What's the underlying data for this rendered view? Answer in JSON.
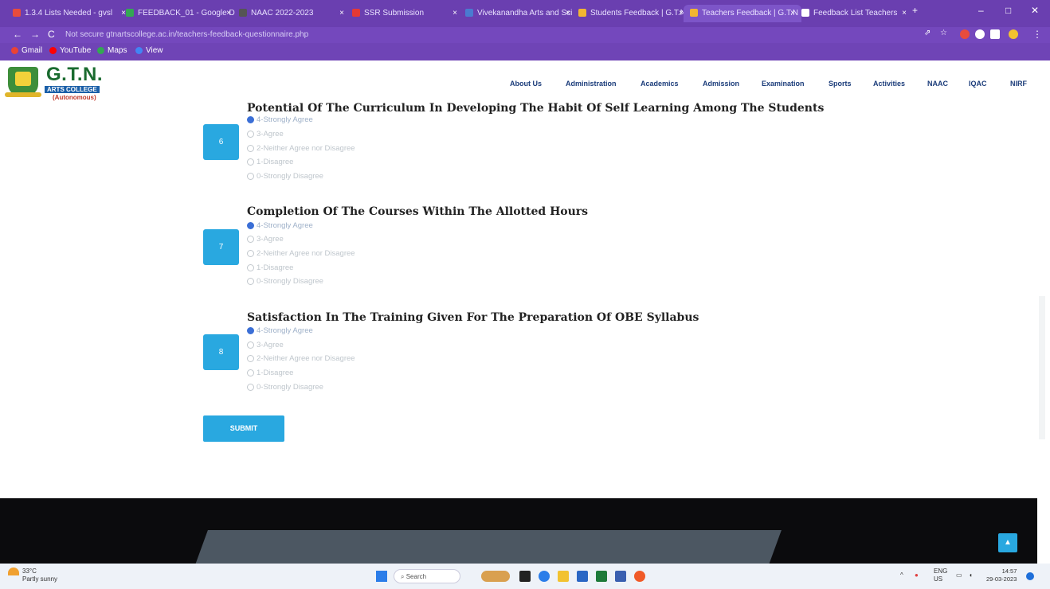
{
  "browser": {
    "tabs": [
      {
        "title": "1.3.4 Lists Needed - gvsl",
        "color": "#e74c3c"
      },
      {
        "title": "FEEDBACK_01 - Google D",
        "color": "#34a853"
      },
      {
        "title": "NAAC 2022-2023",
        "color": "#555555"
      },
      {
        "title": "SSR Submission",
        "color": "#e53935"
      },
      {
        "title": "Vivekanandha Arts and Sci",
        "color": "#4a7bd0"
      },
      {
        "title": "Students Feedback | G.T.N",
        "color": "#f2b632"
      },
      {
        "title": "Teachers Feedback | G.T.N",
        "color": "#f2b632"
      },
      {
        "title": "Feedback List Teachers",
        "color": "#ffffff"
      }
    ],
    "url": "Not secure   gtnartscollege.ac.in/teachers-feedback-questionnaire.php",
    "bookmarks": [
      {
        "label": "Gmail",
        "color": "#ea4335"
      },
      {
        "label": "YouTube",
        "color": "#ff0000"
      },
      {
        "label": "Maps",
        "color": "#34a853"
      },
      {
        "label": "View",
        "color": "#4285f4"
      }
    ]
  },
  "site": {
    "logo_title": "G.T.N.",
    "logo_sub": "ARTS COLLEGE",
    "logo_autonomous": "(Autonomous)",
    "nav": [
      "About Us",
      "Administration",
      "Academics",
      "Admission",
      "Examination",
      "Sports",
      "Activities",
      "NAAC",
      "IQAC",
      "NIRF"
    ]
  },
  "questions": [
    {
      "number": "6",
      "title": "Potential Of The Curriculum In Developing The Habit Of Self Learning Among The Students",
      "options": [
        "4-Strongly Agree",
        "3-Agree",
        "2-Neither Agree nor Disagree",
        "1-Disagree",
        "0-Strongly Disagree"
      ],
      "selected_index": 0
    },
    {
      "number": "7",
      "title": "Completion Of The Courses Within The Allotted Hours",
      "options": [
        "4-Strongly Agree",
        "3-Agree",
        "2-Neither Agree nor Disagree",
        "1-Disagree",
        "0-Strongly Disagree"
      ],
      "selected_index": 0
    },
    {
      "number": "8",
      "title": "Satisfaction In The Training Given For The Preparation Of OBE Syllabus",
      "options": [
        "4-Strongly Agree",
        "3-Agree",
        "2-Neither Agree nor Disagree",
        "1-Disagree",
        "0-Strongly Disagree"
      ],
      "selected_index": 0
    }
  ],
  "submit_label": "SUBMIT",
  "taskbar": {
    "weather_temp": "33°C",
    "weather_desc": "Partly sunny",
    "search_placeholder": "Search",
    "lang": "ENG",
    "region": "US",
    "time": "14:57",
    "date": "29-03-2023"
  }
}
